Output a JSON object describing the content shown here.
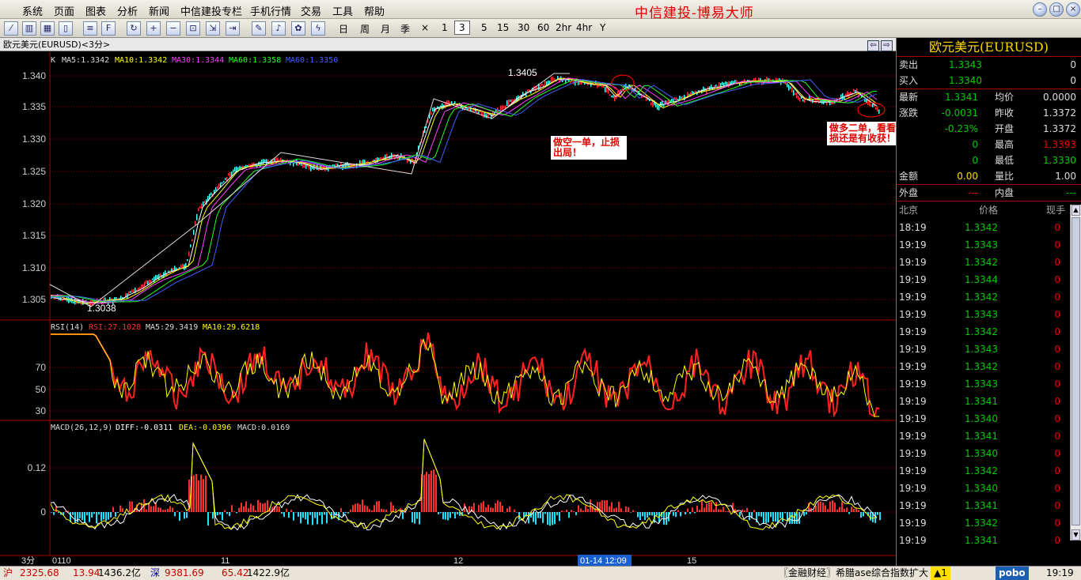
{
  "menu": {
    "items": [
      "系统",
      "页面",
      "图表",
      "分析",
      "新闻",
      "中信建投专栏",
      "手机行情",
      "交易",
      "工具",
      "帮助"
    ],
    "brand": "中信建投-博易大师"
  },
  "toolbar": {
    "periods": [
      "日",
      "周",
      "月",
      "季",
      "×",
      "1",
      "3",
      "5",
      "15",
      "30",
      "60",
      "2hr",
      "4hr",
      "Y"
    ],
    "active_period": "3"
  },
  "chart": {
    "title": "欧元美元(EURUSD)<3分>",
    "main_legend": {
      "k": "K",
      "ma5": "MA5:1.3342",
      "ma10": "MA10:1.3342",
      "ma30": "MA30:1.3344",
      "ma60a": "MA60:1.3358",
      "ma60b": "MA60:1.3350"
    },
    "price_ticks": [
      "1.340",
      "1.335",
      "1.330",
      "1.325",
      "1.320",
      "1.315",
      "1.310",
      "1.305"
    ],
    "high_label": "1.3405",
    "low_label": "1.3038",
    "notes": {
      "short": "做空一单，止损出局！",
      "long": "做多二单，看看是止损还是有收获！"
    },
    "rsi_legend": {
      "name": "RSI(14)",
      "rsi": "RSI:27.1028",
      "ma5": "MA5:29.3419",
      "ma10": "MA10:29.6218"
    },
    "rsi_ticks": [
      "70",
      "50",
      "30"
    ],
    "macd_legend": {
      "name": "MACD(26,12,9)",
      "diff": "DIFF:-0.0311",
      "dea": "DEA:-0.0396",
      "macd": "MACD:0.0169"
    },
    "macd_ticks": [
      "0.12",
      "0"
    ],
    "period_label": "3分",
    "x_labels": [
      "0110",
      "11",
      "12",
      "15"
    ],
    "cursor_time": "01-14 12:09"
  },
  "quote": {
    "title": "欧元美元(EURUSD)",
    "sell_label": "卖出",
    "sell_price": "1.3343",
    "sell_vol": "0",
    "buy_label": "买入",
    "buy_price": "1.3340",
    "buy_vol": "0",
    "rows": [
      {
        "l1": "最新",
        "v1": "1.3341",
        "l2": "均价",
        "v2": "0.0000",
        "v2color": "#ddd"
      },
      {
        "l1": "涨跌",
        "v1": "-0.0031",
        "l2": "昨收",
        "v2": "1.3372",
        "v2color": "#ddd"
      },
      {
        "l1": "",
        "v1": "-0.23%",
        "l2": "开盘",
        "v2": "1.3372",
        "v2color": "#ddd"
      },
      {
        "l1": "",
        "v1": "0",
        "l2": "最高",
        "v2": "1.3393",
        "v2color": "#e00"
      },
      {
        "l1": "",
        "v1": "0",
        "l2": "最低",
        "v2": "1.3330",
        "v2color": "#0c0"
      }
    ],
    "amount_label": "金额",
    "amount": "0.00",
    "ratio_label": "量比",
    "ratio": "1.00",
    "outer_label": "外盘",
    "outer": "---",
    "inner_label": "内盘",
    "inner": "---"
  },
  "ticks": {
    "headers": [
      "北京",
      "价格",
      "现手"
    ],
    "rows": [
      {
        "t": "18:19",
        "p": "1.3342",
        "q": "0"
      },
      {
        "t": "19:19",
        "p": "1.3343",
        "q": "0"
      },
      {
        "t": "19:19",
        "p": "1.3342",
        "q": "0"
      },
      {
        "t": "19:19",
        "p": "1.3344",
        "q": "0"
      },
      {
        "t": "19:19",
        "p": "1.3342",
        "q": "0"
      },
      {
        "t": "19:19",
        "p": "1.3343",
        "q": "0"
      },
      {
        "t": "19:19",
        "p": "1.3342",
        "q": "0"
      },
      {
        "t": "19:19",
        "p": "1.3343",
        "q": "0"
      },
      {
        "t": "19:19",
        "p": "1.3342",
        "q": "0"
      },
      {
        "t": "19:19",
        "p": "1.3343",
        "q": "0"
      },
      {
        "t": "19:19",
        "p": "1.3341",
        "q": "0"
      },
      {
        "t": "19:19",
        "p": "1.3340",
        "q": "0"
      },
      {
        "t": "19:19",
        "p": "1.3341",
        "q": "0"
      },
      {
        "t": "19:19",
        "p": "1.3340",
        "q": "0"
      },
      {
        "t": "19:19",
        "p": "1.3342",
        "q": "0"
      },
      {
        "t": "19:19",
        "p": "1.3340",
        "q": "0"
      },
      {
        "t": "19:19",
        "p": "1.3341",
        "q": "0"
      },
      {
        "t": "19:19",
        "p": "1.3342",
        "q": "0"
      },
      {
        "t": "19:19",
        "p": "1.3341",
        "q": "0"
      }
    ]
  },
  "status": {
    "sh_label": "沪",
    "sh_index": "2325.68",
    "sh_change": "13.94",
    "sh_amount": "1436.2亿",
    "sz_label": "深",
    "sz_index": "9381.69",
    "sz_change": "65.42",
    "sz_amount": "1422.9亿",
    "news": "〖金融财经〗希腊ase综合指数扩大",
    "alert": "▲1",
    "logo": "pobo",
    "clock": "19:19"
  }
}
